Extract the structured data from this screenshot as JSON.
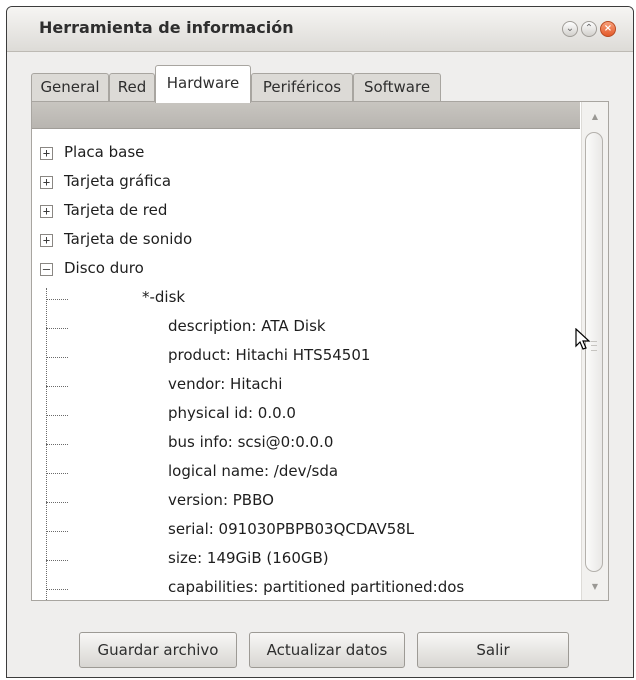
{
  "window": {
    "title": "Herramienta de información"
  },
  "tabs": [
    {
      "label": "General"
    },
    {
      "label": "Red"
    },
    {
      "label": "Hardware",
      "active": true
    },
    {
      "label": "Periféricos"
    },
    {
      "label": "Software"
    }
  ],
  "tree": {
    "categories": [
      {
        "label": "Placa base",
        "expander": "+"
      },
      {
        "label": "Tarjeta gráfica",
        "expander": "+"
      },
      {
        "label": "Tarjeta de red",
        "expander": "+"
      },
      {
        "label": "Tarjeta de sonido",
        "expander": "+"
      },
      {
        "label": "Disco duro",
        "expander": "–"
      }
    ],
    "disk_rows": [
      "*-disk",
      "description: ATA Disk",
      "product: Hitachi HTS54501",
      "vendor: Hitachi",
      "physical id: 0.0.0",
      "bus info: scsi@0:0.0.0",
      "logical name: /dev/sda",
      "version: PBBO",
      "serial: 091030PBPB03QCDAV58L",
      "size: 149GiB (160GB)",
      "capabilities: partitioned partitioned:dos"
    ]
  },
  "buttons": {
    "save": "Guardar archivo",
    "refresh": "Actualizar datos",
    "exit": "Salir"
  },
  "icons": {
    "minimize": "chevron-down-icon",
    "maximize": "chevron-up-icon",
    "close": "close-icon",
    "cursor": "mouse-pointer-icon"
  }
}
